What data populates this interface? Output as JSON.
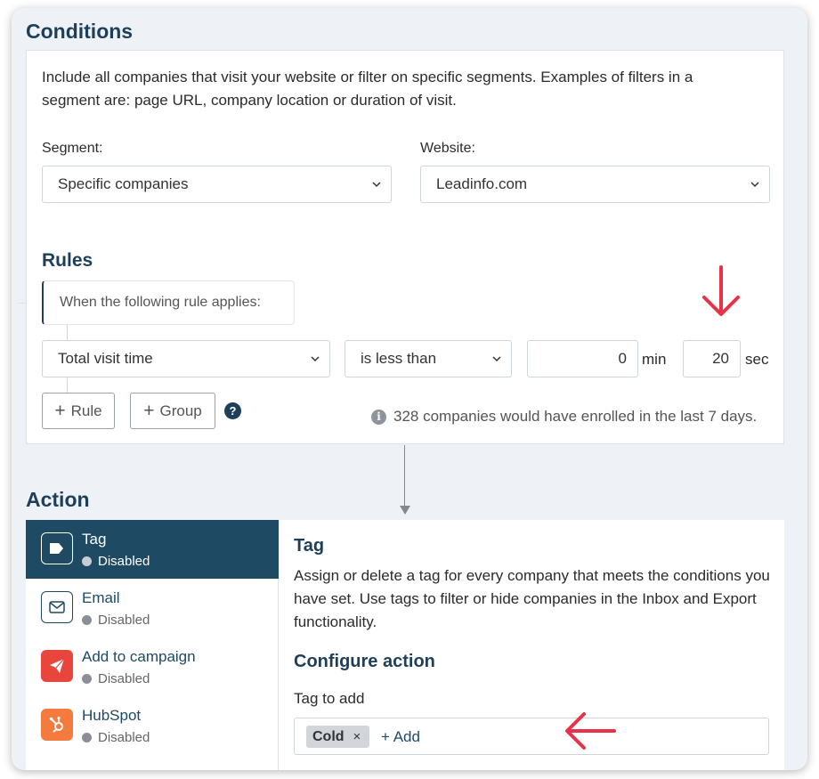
{
  "conditions": {
    "title": "Conditions",
    "description": "Include all companies that visit your website or filter on specific segments. Examples of filters in a segment are: page URL, company location or duration of visit.",
    "segment_label": "Segment:",
    "segment_value": "Specific companies",
    "website_label": "Website:",
    "website_value": "Leadinfo.com"
  },
  "rules": {
    "title": "Rules",
    "applies_text": "When the following rule applies:",
    "field": "Total visit time",
    "operator": "is less than",
    "minutes_value": "0",
    "minutes_unit": "min",
    "seconds_value": "20",
    "seconds_unit": "sec",
    "add_rule_label": "Rule",
    "add_group_label": "Group",
    "help_glyph": "?",
    "enrolled_text": "328 companies would have enrolled in the last 7 days."
  },
  "action": {
    "title": "Action",
    "items": [
      {
        "name": "Tag",
        "status": "Disabled",
        "icon": "tag-icon",
        "active": true
      },
      {
        "name": "Email",
        "status": "Disabled",
        "icon": "email-icon"
      },
      {
        "name": "Add to campaign",
        "status": "Disabled",
        "icon": "campaign-icon",
        "color": "#e8453c"
      },
      {
        "name": "HubSpot",
        "status": "Disabled",
        "icon": "hubspot-icon",
        "color": "#f57a3d"
      }
    ],
    "panel": {
      "title": "Tag",
      "description": "Assign or delete a tag for every company that meets the conditions you have set. Use tags to filter or hide companies in the Inbox and Export functionality.",
      "configure_title": "Configure action",
      "tag_label": "Tag to add",
      "tag_value": "Cold",
      "tag_remove": "×",
      "add_label": "+ Add"
    }
  },
  "colors": {
    "primary": "#1e3f5a",
    "active_bg": "#1e4a63",
    "annotation": "#e8324a",
    "page_bg": "#eef2f7"
  }
}
